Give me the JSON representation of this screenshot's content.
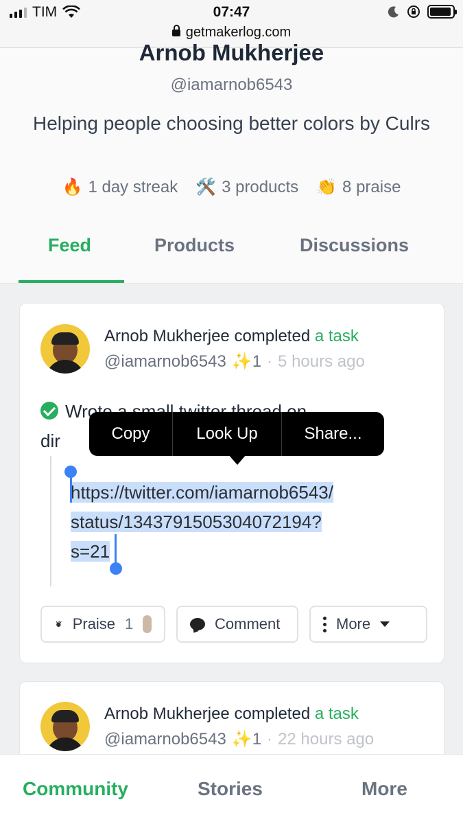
{
  "status_bar": {
    "carrier": "TIM",
    "time": "07:47",
    "url": "getmakerlog.com",
    "battery_level": 0.95
  },
  "profile": {
    "name": "Arnob Mukherjee",
    "handle": "@iamarnob6543",
    "bio": "Helping people choosing better colors by Culrs",
    "stats": [
      {
        "emoji": "🔥",
        "text": "1 day streak"
      },
      {
        "emoji": "🛠️",
        "text": "3 products"
      },
      {
        "emoji": "👏",
        "text": "8 praise"
      }
    ]
  },
  "tabs": [
    {
      "label": "Feed",
      "active": true
    },
    {
      "label": "Products",
      "active": false
    },
    {
      "label": "Discussions",
      "active": false
    }
  ],
  "posts": [
    {
      "author": "Arnob Mukherjee",
      "verb": "completed",
      "object": "a task",
      "handle": "@iamarnob6543",
      "sparkle": "✨1",
      "dot": "·",
      "time": "5 hours ago",
      "task_line1": "Wrote a small twitter thread on",
      "task_line2_prefix": "dir",
      "link_line1": "https://twitter.com/iamarnob6543/",
      "link_line2": "status/1343791505304072194?",
      "link_line3": "s=21",
      "actions": {
        "praise_label": "Praise",
        "praise_count": "1",
        "comment_label": "Comment",
        "more_label": "More"
      }
    },
    {
      "author": "Arnob Mukherjee",
      "verb": "completed",
      "object": "a task",
      "handle": "@iamarnob6543",
      "sparkle": "✨1",
      "dot": "·",
      "time": "22 hours ago"
    }
  ],
  "context_menu": {
    "items": [
      "Copy",
      "Look Up",
      "Share..."
    ]
  },
  "bottom_nav": [
    {
      "label": "Community",
      "active": true
    },
    {
      "label": "Stories",
      "active": false
    },
    {
      "label": "More",
      "active": false
    }
  ],
  "colors": {
    "accent": "#27ae60",
    "selection": "#c9defa",
    "handle": "#3b82f6"
  }
}
